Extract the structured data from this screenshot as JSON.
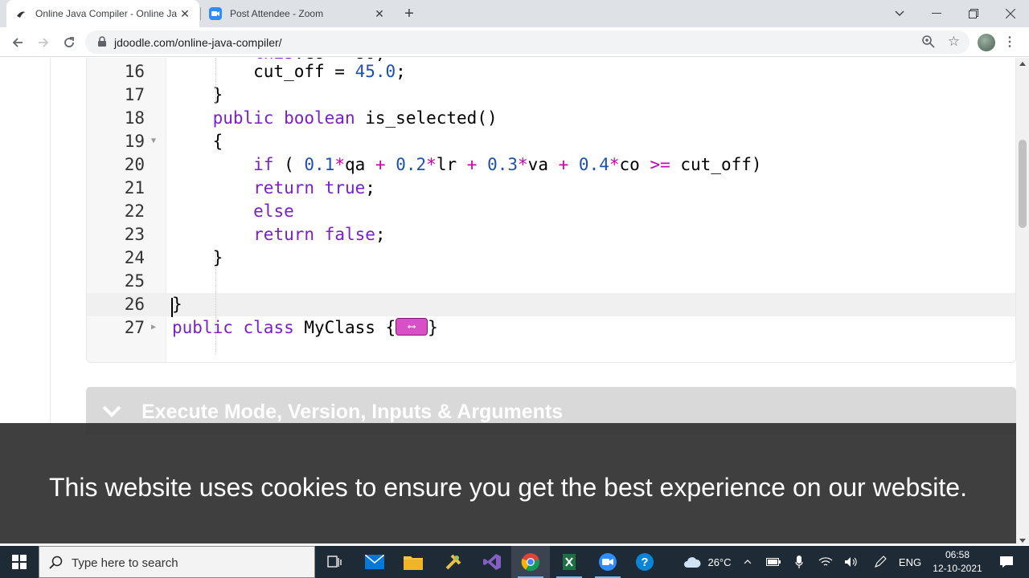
{
  "browser": {
    "tabs": [
      {
        "title": "Online Java Compiler - Online Ja",
        "active": true
      },
      {
        "title": "Post Attendee - Zoom",
        "active": false
      }
    ],
    "new_tab_symbol": "+",
    "url": "jdoodle.com/online-java-compiler/"
  },
  "editor": {
    "lines": [
      {
        "number": "16",
        "tokens": [
          {
            "t": "        cut_off = ",
            "c": ""
          },
          {
            "t": "45.0",
            "c": "num"
          },
          {
            "t": ";",
            "c": ""
          }
        ]
      },
      {
        "number": "17",
        "tokens": [
          {
            "t": "    }",
            "c": ""
          }
        ]
      },
      {
        "number": "18",
        "tokens": [
          {
            "t": "    ",
            "c": ""
          },
          {
            "t": "public",
            "c": "kw"
          },
          {
            "t": " ",
            "c": ""
          },
          {
            "t": "boolean",
            "c": "kw"
          },
          {
            "t": " is_selected()",
            "c": ""
          }
        ]
      },
      {
        "number": "19",
        "fold": true,
        "tokens": [
          {
            "t": "    {",
            "c": ""
          }
        ]
      },
      {
        "number": "20",
        "tokens": [
          {
            "t": "        ",
            "c": ""
          },
          {
            "t": "if",
            "c": "kw"
          },
          {
            "t": " ( ",
            "c": ""
          },
          {
            "t": "0.1",
            "c": "num"
          },
          {
            "t": "*",
            "c": "op"
          },
          {
            "t": "qa ",
            "c": ""
          },
          {
            "t": "+",
            "c": "op"
          },
          {
            "t": " ",
            "c": ""
          },
          {
            "t": "0.2",
            "c": "num"
          },
          {
            "t": "*",
            "c": "op"
          },
          {
            "t": "lr ",
            "c": ""
          },
          {
            "t": "+",
            "c": "op"
          },
          {
            "t": " ",
            "c": ""
          },
          {
            "t": "0.3",
            "c": "num"
          },
          {
            "t": "*",
            "c": "op"
          },
          {
            "t": "va ",
            "c": ""
          },
          {
            "t": "+",
            "c": "op"
          },
          {
            "t": " ",
            "c": ""
          },
          {
            "t": "0.4",
            "c": "num"
          },
          {
            "t": "*",
            "c": "op"
          },
          {
            "t": "co ",
            "c": ""
          },
          {
            "t": ">=",
            "c": "op"
          },
          {
            "t": " cut_off)",
            "c": ""
          }
        ]
      },
      {
        "number": "21",
        "tokens": [
          {
            "t": "        ",
            "c": ""
          },
          {
            "t": "return",
            "c": "kw"
          },
          {
            "t": " ",
            "c": ""
          },
          {
            "t": "true",
            "c": "kw"
          },
          {
            "t": ";",
            "c": ""
          }
        ]
      },
      {
        "number": "22",
        "tokens": [
          {
            "t": "        ",
            "c": ""
          },
          {
            "t": "else",
            "c": "kw"
          }
        ]
      },
      {
        "number": "23",
        "tokens": [
          {
            "t": "        ",
            "c": ""
          },
          {
            "t": "return",
            "c": "kw"
          },
          {
            "t": " ",
            "c": ""
          },
          {
            "t": "false",
            "c": "kw"
          },
          {
            "t": ";",
            "c": ""
          }
        ]
      },
      {
        "number": "24",
        "tokens": [
          {
            "t": "    }",
            "c": ""
          }
        ]
      },
      {
        "number": "25",
        "tokens": []
      },
      {
        "number": "26",
        "active": true,
        "tokens": [
          {
            "t": "}",
            "c": ""
          }
        ]
      },
      {
        "number": "27",
        "fold": true,
        "folded": true,
        "tokens": [
          {
            "t": "public",
            "c": "kw"
          },
          {
            "t": " ",
            "c": ""
          },
          {
            "t": "class",
            "c": "kw"
          },
          {
            "t": " MyClass {",
            "c": ""
          },
          {
            "t": "FOLD",
            "c": "fold"
          },
          {
            "t": "}",
            "c": ""
          }
        ]
      }
    ]
  },
  "accordion": {
    "label": "Execute Mode, Version, Inputs & Arguments"
  },
  "cookie_banner": {
    "message": "This website uses cookies to ensure you get the best experience on our website."
  },
  "taskbar": {
    "search_placeholder": "Type here to search",
    "weather": "26°C",
    "language": "ENG",
    "time": "06:58",
    "date": "12-10-2021"
  },
  "colors": {
    "keyword": "#7a1fc9",
    "number": "#1c50b3",
    "operator": "#c400b0",
    "taskbar": "#1f2a37"
  }
}
